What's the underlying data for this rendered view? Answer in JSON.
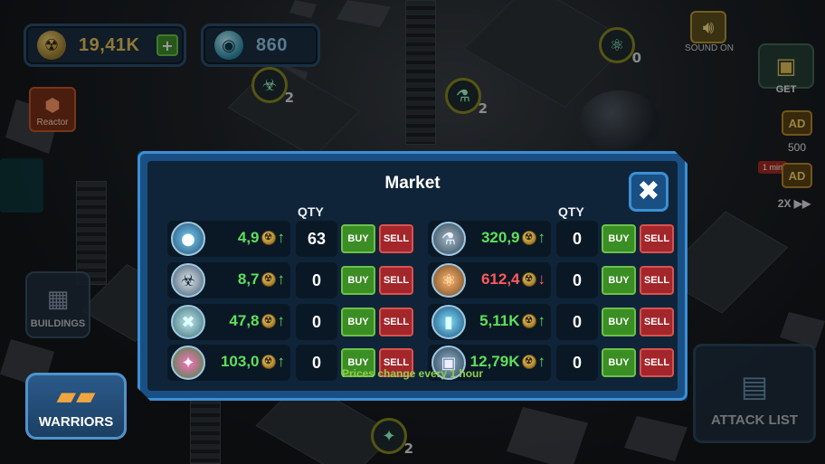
{
  "hud": {
    "gold": {
      "icon": "radiation-coin-icon",
      "value": "19,41K",
      "add_label": "+"
    },
    "gems": {
      "icon": "gem-orb-icon",
      "value": "860"
    },
    "reactor": {
      "icon": "reactor-icon",
      "label": "Reactor"
    },
    "sound": {
      "icon": "speaker-icon",
      "label": "SOUND ON"
    },
    "get": {
      "icon": "treasure-chest-icon",
      "label": "GET"
    },
    "ad_reward": {
      "label": "AD",
      "value": "500"
    },
    "ad_speed": {
      "label": "AD",
      "timer": "1 min",
      "speed": "2X ▶▶"
    },
    "buildings": {
      "icon": "buildings-icon",
      "label": "BUILDINGS"
    },
    "warriors": {
      "icon": "tanks-icon",
      "label": "WARRIORS"
    },
    "attack_list": {
      "icon": "attack-list-icon",
      "label": "ATTACK LIST"
    }
  },
  "market": {
    "title": "Market",
    "close_glyph": "✖",
    "qty_header": "QTY",
    "buy_label": "BUY",
    "sell_label": "SELL",
    "footer": "Prices change every 1 hour",
    "left_items": [
      {
        "icon": "orbs-icon",
        "price": "4,9",
        "trend": "up",
        "qty": "63"
      },
      {
        "icon": "biohazard-icon",
        "price": "8,7",
        "trend": "up",
        "qty": "0"
      },
      {
        "icon": "crystal-cube-icon",
        "price": "47,8",
        "trend": "up",
        "qty": "0"
      },
      {
        "icon": "gem-cluster-icon",
        "price": "103,0",
        "trend": "up",
        "qty": "0"
      }
    ],
    "right_items": [
      {
        "icon": "jar-icon",
        "price": "320,9",
        "trend": "up",
        "qty": "0"
      },
      {
        "icon": "atom-icon",
        "price": "612,4",
        "trend": "down",
        "qty": "0"
      },
      {
        "icon": "energy-cell-icon",
        "price": "5,11K",
        "trend": "up",
        "qty": "0"
      },
      {
        "icon": "crate-icon",
        "price": "12,79K",
        "trend": "up",
        "qty": "0"
      }
    ]
  },
  "world_labels": {
    "count_a": "2",
    "count_b": "2",
    "count_c": "0",
    "count_d": "2"
  },
  "colors": {
    "price_up": "#5de05a",
    "price_down": "#ff5a5a",
    "buy": "#3b8e24",
    "sell": "#a3262b",
    "panel": "#1a4f84"
  }
}
